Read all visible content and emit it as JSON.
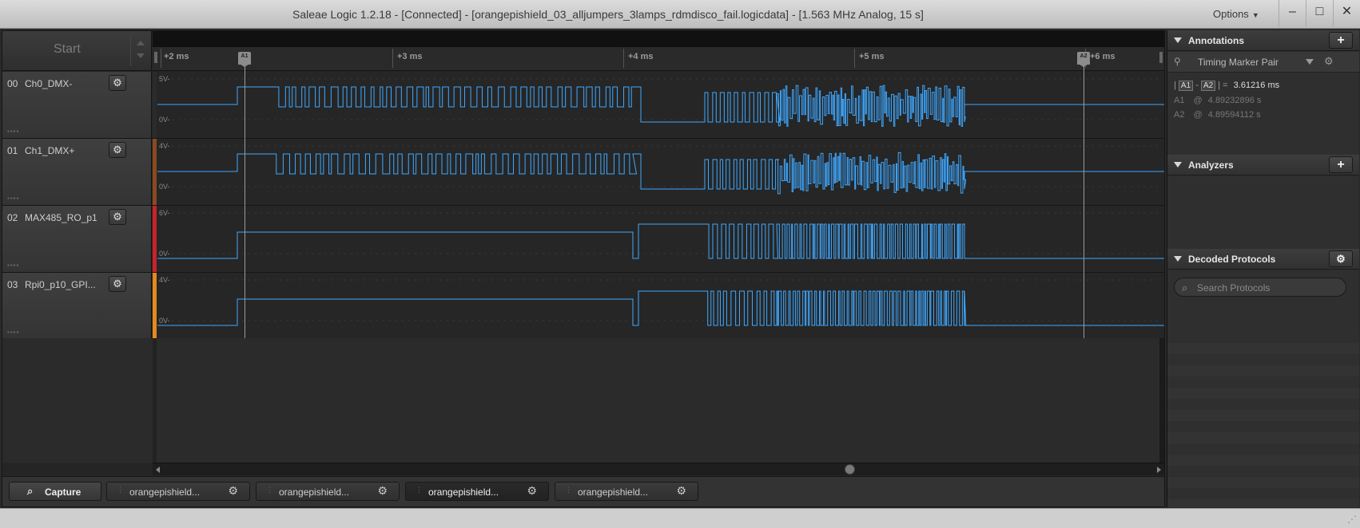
{
  "window": {
    "title": "Saleae Logic 1.2.18 - [Connected] - [orangepishield_03_alljumpers_3lamps_rdmdisco_fail.logicdata] - [1.563 MHz Analog, 15 s]",
    "options_label": "Options",
    "minimize_glyph": "–",
    "maximize_glyph": "□",
    "close_glyph": "✕"
  },
  "toolbar": {
    "start_label": "Start"
  },
  "ruler": {
    "ticks": [
      "+2 ms",
      "+3 ms",
      "+4 ms",
      "+5 ms",
      "+6 ms"
    ],
    "markers": [
      "A1",
      "A2"
    ]
  },
  "channels": [
    {
      "num": "00",
      "name": "Ch0_DMX-",
      "color": "#2b2b2b",
      "top_label": "5V-",
      "bottom_label": "0V-"
    },
    {
      "num": "01",
      "name": "Ch1_DMX+",
      "color": "#8a4a1e",
      "top_label": "4V-",
      "bottom_label": "0V-"
    },
    {
      "num": "02",
      "name": "MAX485_RO_p1",
      "color": "#c8232a",
      "top_label": "6V-",
      "bottom_label": "0V-"
    },
    {
      "num": "03",
      "name": "Rpi0_p10_GPI...",
      "color": "#e38a1c",
      "top_label": "4V-",
      "bottom_label": "0V-"
    }
  ],
  "tabs": {
    "capture_label": "Capture",
    "items": [
      "orangepishield...",
      "orangepishield...",
      "orangepishield...",
      "orangepishield..."
    ],
    "active_index": 2
  },
  "sidebar": {
    "annotations": {
      "title": "Annotations",
      "marker_pair": "Timing Marker Pair",
      "diff_prefix": "|",
      "diff_a1": "A1",
      "diff_sep": "-",
      "diff_a2": "A2",
      "diff_suffix": "|  =",
      "diff_value": "3.61216 ms",
      "a1_label": "A1",
      "a1_value": "4.89232896 s",
      "a2_label": "A2",
      "a2_value": "4.89594112 s",
      "at": "@"
    },
    "analyzers": {
      "title": "Analyzers"
    },
    "decoded": {
      "title": "Decoded Protocols",
      "search_placeholder": "Search Protocols"
    }
  },
  "colors": {
    "signal": "#3fa8ff",
    "accent": "#3a3a3a"
  }
}
